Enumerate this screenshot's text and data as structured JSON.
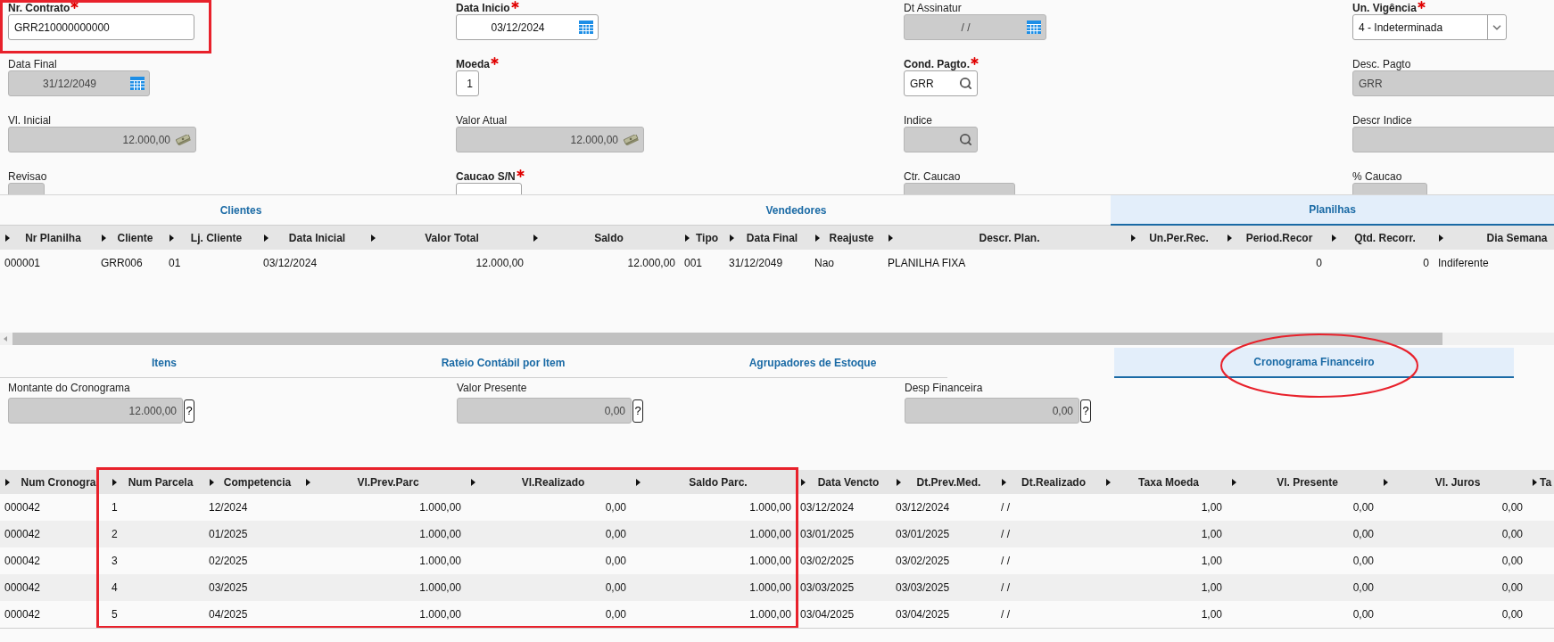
{
  "contract_form": {
    "fields": [
      {
        "label": "Nr. Contrato",
        "required": true,
        "kind": "text",
        "disabled": false,
        "value": "GRR210000000000"
      },
      {
        "label": "Data Inicio",
        "required": true,
        "kind": "date",
        "disabled": false,
        "value": "03/12/2024"
      },
      {
        "label": "Dt Assinatur",
        "required": false,
        "kind": "date",
        "disabled": true,
        "value": "/ /"
      },
      {
        "label": "Un. Vigência",
        "required": true,
        "kind": "select",
        "disabled": false,
        "value": "4 - Indeterminada"
      },
      {
        "label": "Data Final",
        "required": false,
        "kind": "date",
        "disabled": true,
        "value": "31/12/2049"
      },
      {
        "label": "Moeda",
        "required": true,
        "kind": "number",
        "disabled": false,
        "value": "1"
      },
      {
        "label": "Cond. Pagto.",
        "required": true,
        "kind": "lookup",
        "disabled": false,
        "value": "GRR"
      },
      {
        "label": "Desc. Pagto",
        "required": false,
        "kind": "text",
        "disabled": true,
        "value": "GRR"
      },
      {
        "label": "Vl. Inicial",
        "required": false,
        "kind": "money",
        "disabled": true,
        "value": "12.000,00"
      },
      {
        "label": "Valor Atual",
        "required": false,
        "kind": "money",
        "disabled": true,
        "value": "12.000,00"
      },
      {
        "label": "Indice",
        "required": false,
        "kind": "lookup",
        "disabled": true
      },
      {
        "label": "Descr Indice",
        "required": false,
        "kind": "text",
        "disabled": true
      },
      {
        "label": "Revisao",
        "required": false,
        "kind": "text",
        "disabled": true
      },
      {
        "label": "Caucao S/N",
        "required": true,
        "kind": "text",
        "disabled": false
      },
      {
        "label": "Ctr. Caucao",
        "required": false,
        "kind": "text",
        "disabled": true
      },
      {
        "label": "% Caucao",
        "required": false,
        "kind": "text",
        "disabled": true
      }
    ]
  },
  "upper_tabs": [
    {
      "label": "Clientes",
      "selected": false
    },
    {
      "label": "Vendedores",
      "selected": false
    },
    {
      "label": "Planilhas",
      "selected": true
    }
  ],
  "planilhas_table": {
    "columns": [
      {
        "label": "Nr Planilha",
        "kind": "text"
      },
      {
        "label": "Cliente",
        "kind": "text"
      },
      {
        "label": "Lj. Cliente",
        "kind": "text"
      },
      {
        "label": "Data Inicial",
        "kind": "text"
      },
      {
        "label": "Valor Total",
        "kind": "number"
      },
      {
        "label": "Saldo",
        "kind": "number"
      },
      {
        "label": "Tipo",
        "kind": "text"
      },
      {
        "label": "Data Final",
        "kind": "text"
      },
      {
        "label": "Reajuste",
        "kind": "text"
      },
      {
        "label": "Descr. Plan.",
        "kind": "text"
      },
      {
        "label": "Un.Per.Rec."
      },
      {
        "label": "Period.Recor",
        "kind": "number"
      },
      {
        "label": "Qtd. Recorr.",
        "kind": "number"
      },
      {
        "label": "Dia Semana",
        "kind": "text"
      }
    ],
    "rows": [
      [
        "000001",
        "GRR006",
        "01",
        "03/12/2024",
        "12.000,00",
        "12.000,00",
        "001",
        "31/12/2049",
        "Nao",
        "PLANILHA FIXA",
        null,
        "0",
        "0",
        "Indiferente"
      ]
    ]
  },
  "lower_tabs": [
    {
      "label": "Itens",
      "selected": false
    },
    {
      "label": "Rateio Contábil por Item",
      "selected": false
    },
    {
      "label": "Agrupadores de Estoque",
      "selected": false
    },
    {
      "label": "Cronograma Financeiro",
      "selected": true
    }
  ],
  "cronograma_fields": [
    {
      "label": "Montante do Cronograma",
      "value": "12.000,00",
      "help": "?"
    },
    {
      "label": "Valor Presente",
      "value": "0,00",
      "help": "?"
    },
    {
      "label": "Desp Financeira",
      "value": "0,00",
      "help": "?"
    }
  ],
  "cronograma_table": {
    "columns": [
      {
        "label": "Num Cronogra",
        "kind": "text"
      },
      {
        "label": "Num Parcela",
        "kind": "text"
      },
      {
        "label": "Competencia",
        "kind": "text"
      },
      {
        "label": "Vl.Prev.Parc",
        "kind": "number"
      },
      {
        "label": "Vl.Realizado",
        "kind": "number"
      },
      {
        "label": "Saldo Parc.",
        "kind": "number"
      },
      {
        "label": "Data Vencto",
        "kind": "text"
      },
      {
        "label": "Dt.Prev.Med.",
        "kind": "text"
      },
      {
        "label": "Dt.Realizado",
        "kind": "text"
      },
      {
        "label": "Taxa Moeda",
        "kind": "number"
      },
      {
        "label": "Vl. Presente",
        "kind": "number"
      },
      {
        "label": "Vl. Juros",
        "kind": "number"
      },
      {
        "label": "Ta"
      }
    ],
    "rows": [
      [
        "000042",
        "1",
        "12/2024",
        "1.000,00",
        "0,00",
        "1.000,00",
        "03/12/2024",
        "03/12/2024",
        "/ /",
        "1,00",
        "0,00",
        "0,00"
      ],
      [
        "000042",
        "2",
        "01/2025",
        "1.000,00",
        "0,00",
        "1.000,00",
        "03/01/2025",
        "03/01/2025",
        "/ /",
        "1,00",
        "0,00",
        "0,00"
      ],
      [
        "000042",
        "3",
        "02/2025",
        "1.000,00",
        "0,00",
        "1.000,00",
        "03/02/2025",
        "03/02/2025",
        "/ /",
        "1,00",
        "0,00",
        "0,00"
      ],
      [
        "000042",
        "4",
        "03/2025",
        "1.000,00",
        "0,00",
        "1.000,00",
        "03/03/2025",
        "03/03/2025",
        "/ /",
        "1,00",
        "0,00",
        "0,00"
      ],
      [
        "000042",
        "5",
        "04/2025",
        "1.000,00",
        "0,00",
        "1.000,00",
        "03/04/2025",
        "03/04/2025",
        "/ /",
        "1,00",
        "0,00",
        "0,00"
      ]
    ]
  }
}
